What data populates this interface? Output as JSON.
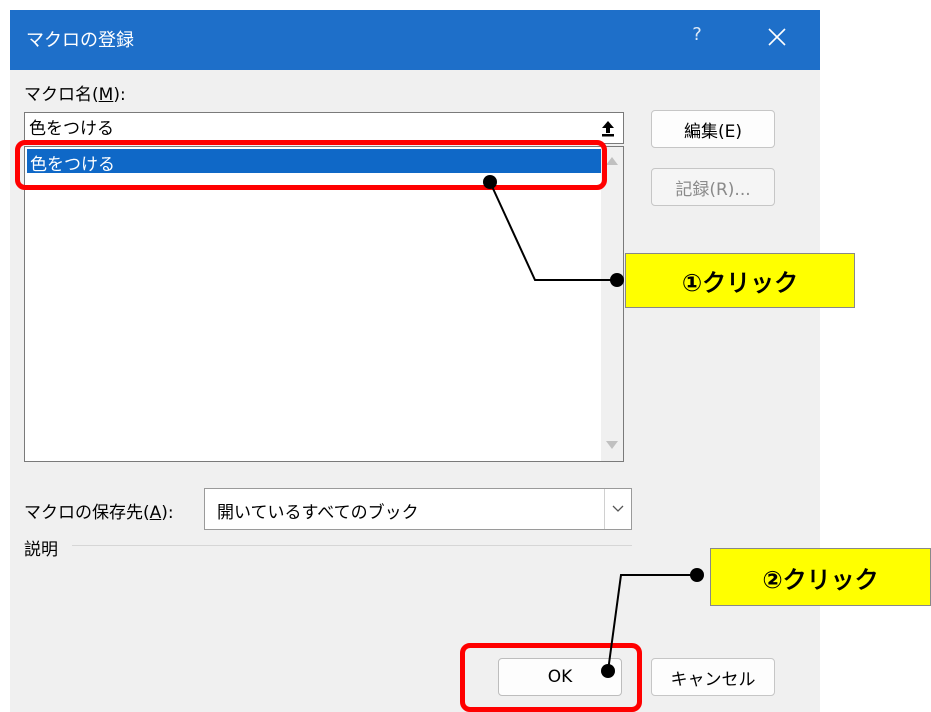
{
  "dialog": {
    "title": "マクロの登録",
    "help_label": "?",
    "macro_name_label": "マクロ名(",
    "macro_name_accel": "M",
    "macro_name_suffix": "):",
    "macro_name_value": "色をつける",
    "macro_list": [
      "色をつける"
    ],
    "edit_button": "編集(E)",
    "record_button": "記録(R)...",
    "store_in_label": "マクロの保存先(",
    "store_in_accel": "A",
    "store_in_suffix": "):",
    "store_in_value": "開いているすべてのブック",
    "description_label": "説明",
    "ok_button": "OK",
    "cancel_button": "キャンセル"
  },
  "annotations": {
    "step1": "①クリック",
    "step2": "②クリック",
    "highlight_color": "#ff0000",
    "callout_color": "#ffff00"
  },
  "colors": {
    "titlebar": "#1e6fc9",
    "selection": "#0f68c7"
  }
}
